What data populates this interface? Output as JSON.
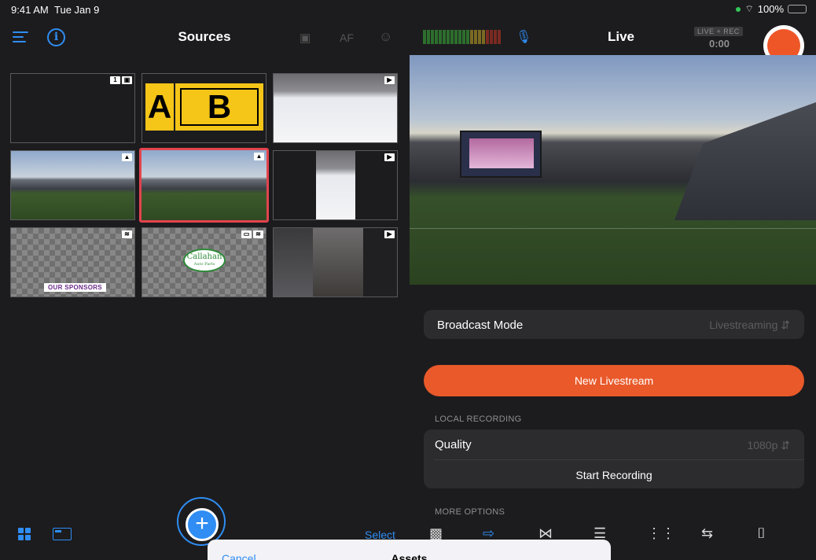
{
  "status_bar": {
    "time": "9:41 AM",
    "date": "Tue Jan 9",
    "battery": "100%"
  },
  "sources_header": {
    "title": "Sources",
    "af_label": "AF",
    "icons": [
      "menu-icon",
      "info-icon",
      "camera-icon",
      "person-add-icon"
    ]
  },
  "source_tiles": [
    {
      "name": "tile-camera-1",
      "badges": [
        "1",
        "▣"
      ]
    },
    {
      "name": "tile-ab-graphic",
      "letter_a": "A",
      "letter_b": "B"
    },
    {
      "name": "tile-hockey-video",
      "badges": [
        "▶"
      ]
    },
    {
      "name": "tile-stadium-image",
      "badges": [
        "▲"
      ]
    },
    {
      "name": "tile-stadium-image-selected",
      "badges": [
        "▲"
      ]
    },
    {
      "name": "tile-hockey-vertical-video",
      "badges": [
        "▶"
      ]
    },
    {
      "name": "tile-sponsors-overlay",
      "badges": [
        "≋"
      ],
      "label": "OUR SPONSORS"
    },
    {
      "name": "tile-callahan-logo",
      "badges": [
        "▭",
        "≋"
      ],
      "logo_text": "Callahan",
      "logo_sub": "Auto Parts"
    },
    {
      "name": "tile-collage-video",
      "badges": [
        "▶"
      ]
    }
  ],
  "live_header": {
    "title": "Live",
    "rec_badge": "LIVE + REC",
    "rec_time": "0:00"
  },
  "broadcast_mode": {
    "label": "Broadcast Mode",
    "value": "Livestreaming"
  },
  "new_livestream_label": "New Livestream",
  "local_recording": {
    "section": "LOCAL RECORDING",
    "quality_label": "Quality",
    "quality_value": "1080p",
    "start_label": "Start Recording"
  },
  "more_options_label": "MORE OPTIONS",
  "bottom_bar": {
    "select_label": "Select"
  },
  "sheet": {
    "cancel_label": "Cancel",
    "title": "Assets"
  },
  "colors": {
    "accent": "#2f8df3",
    "record": "#ee5628",
    "livestream_button": "#e9592a",
    "selected_border": "#e3444e"
  }
}
